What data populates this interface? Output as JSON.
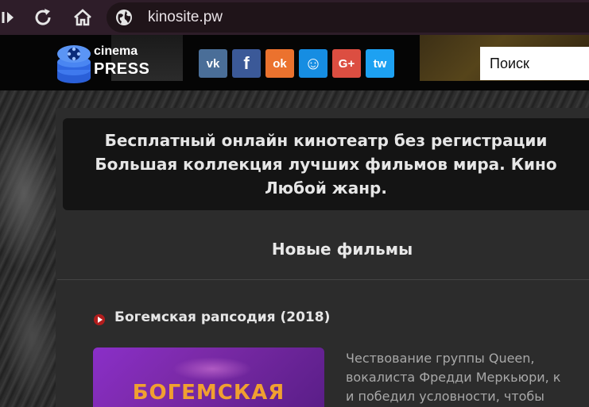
{
  "browser": {
    "url": "kinosite.pw"
  },
  "header": {
    "logo_line1": "cinema",
    "logo_line2": "PRESS",
    "social": [
      {
        "name": "vk-icon",
        "label": "vk",
        "color": "#4a6e98"
      },
      {
        "name": "facebook-icon",
        "label": "f",
        "color": "#3b5998"
      },
      {
        "name": "odnoklassniki-icon",
        "label": "ok",
        "color": "#eb722e"
      },
      {
        "name": "moimir-icon",
        "label": "☺",
        "color": "#168de2"
      },
      {
        "name": "googleplus-icon",
        "label": "G+",
        "color": "#dc4e41"
      },
      {
        "name": "twitter-icon",
        "label": "tw",
        "color": "#1da1f2"
      }
    ],
    "search_placeholder": "Поиск"
  },
  "description": {
    "line1": "Бесплатный онлайн кинотеатр без регистрации",
    "line2": "Большая коллекция лучших фильмов мира. Кино",
    "line3": "Любой жанр."
  },
  "section": {
    "title": "Новые фильмы"
  },
  "movie": {
    "title": "Богемская рапсодия (2018)",
    "poster_text": "БОГЕМСКАЯ",
    "desc_lines": [
      "Чествование группы Queen,",
      "вокалиста Фредди Меркьюри, к",
      "и победил условности, чтобы"
    ]
  }
}
